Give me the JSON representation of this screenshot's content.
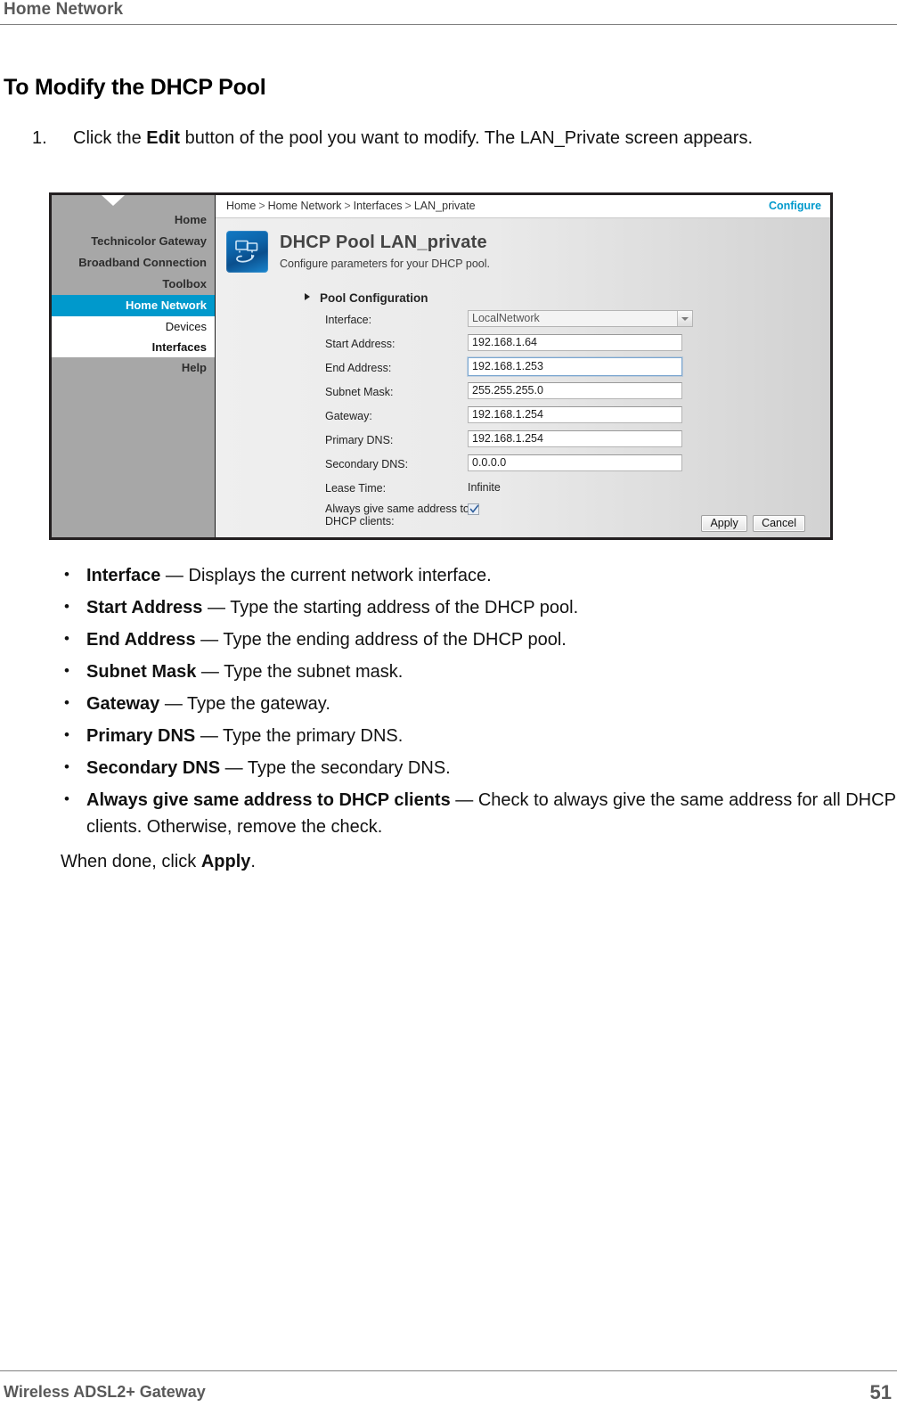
{
  "page": {
    "running_header": "Home Network",
    "section_title": "To Modify the DHCP Pool",
    "step": {
      "number": "1.",
      "text_before": "Click the ",
      "bold": "Edit",
      "text_after": " button of the pool you want to modify. The LAN_Private screen appears."
    },
    "closing": {
      "text_before": "When done, click ",
      "bold": "Apply",
      "text_after": "."
    }
  },
  "bullets": [
    {
      "term": "Interface",
      "dash": " — ",
      "desc": "Displays the current network interface."
    },
    {
      "term": "Start Address",
      "dash": " — ",
      "desc": "Type the starting address of the DHCP pool."
    },
    {
      "term": "End Address",
      "dash": " — ",
      "desc": "Type the ending address of the DHCP pool."
    },
    {
      "term": "Subnet Mask",
      "dash": " — ",
      "desc": "Type the subnet mask."
    },
    {
      "term": "Gateway",
      "dash": " — ",
      "desc": "Type the gateway."
    },
    {
      "term": "Primary DNS",
      "dash": " — ",
      "desc": "Type the primary DNS."
    },
    {
      "term": "Secondary DNS",
      "dash": " — ",
      "desc": "Type the secondary DNS."
    },
    {
      "term": "Always give same address to DHCP clients",
      "dash": " — ",
      "desc": "Check to always give the same address for all DHCP clients. Otherwise, remove the check."
    }
  ],
  "router_screenshot": {
    "sidebar": {
      "top_items": [
        {
          "label": "Home",
          "active": false
        },
        {
          "label": "Technicolor Gateway",
          "active": false
        },
        {
          "label": "Broadband Connection",
          "active": false
        },
        {
          "label": "Toolbox",
          "active": false
        },
        {
          "label": "Home Network",
          "active": true
        }
      ],
      "sub_items": [
        {
          "label": "Devices",
          "bold": false
        },
        {
          "label": "Interfaces",
          "bold": true
        }
      ],
      "help_label": "Help",
      "active_color": "#0099cc"
    },
    "breadcrumb": {
      "items": [
        "Home",
        "Home Network",
        "Interfaces",
        "LAN_private"
      ],
      "separator": ">"
    },
    "configure_link": "Configure",
    "header": {
      "icon": "dhcp-pool-icon",
      "title": "DHCP Pool LAN_private",
      "subtitle": "Configure parameters for your DHCP pool."
    },
    "group_header": "Pool Configuration",
    "fields": [
      {
        "label": "Interface:",
        "value": "LocalNetwork",
        "type": "select",
        "name": "interface-select"
      },
      {
        "label": "Start Address:",
        "value": "192.168.1.64",
        "type": "text",
        "name": "start-address-input"
      },
      {
        "label": "End Address:",
        "value": "192.168.1.253",
        "type": "text",
        "name": "end-address-input",
        "focused": true
      },
      {
        "label": "Subnet Mask:",
        "value": "255.255.255.0",
        "type": "text",
        "name": "subnet-mask-input"
      },
      {
        "label": "Gateway:",
        "value": "192.168.1.254",
        "type": "text",
        "name": "gateway-input"
      },
      {
        "label": "Primary DNS:",
        "value": "192.168.1.254",
        "type": "text",
        "name": "primary-dns-input"
      },
      {
        "label": "Secondary DNS:",
        "value": "0.0.0.0",
        "type": "text",
        "name": "secondary-dns-input"
      },
      {
        "label": "Lease Time:",
        "value": "Infinite",
        "type": "static",
        "name": "lease-time-value"
      }
    ],
    "checkbox_row": {
      "label_line1": "Always give same address to",
      "label_line2": "DHCP clients:",
      "checked": true
    },
    "buttons": {
      "apply": "Apply",
      "cancel": "Cancel"
    }
  },
  "footer": {
    "left": "Wireless ADSL2+ Gateway",
    "page_number": "51"
  }
}
